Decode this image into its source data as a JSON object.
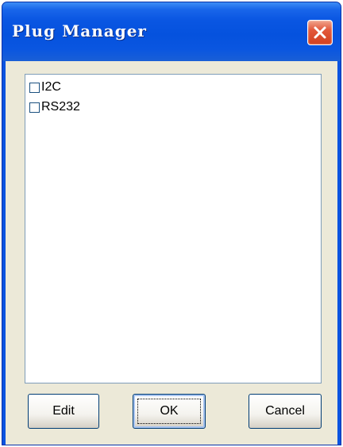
{
  "window": {
    "title": "Plug Manager"
  },
  "plugins": [
    {
      "label": "I2C",
      "checked": false
    },
    {
      "label": "RS232",
      "checked": false
    }
  ],
  "buttons": {
    "edit": "Edit",
    "ok": "OK",
    "cancel": "Cancel"
  },
  "colors": {
    "titlebar": "#0a56e2",
    "close_button": "#e2583a",
    "dialog_background": "#ece9d8"
  },
  "icons": {
    "close": "close-icon"
  }
}
